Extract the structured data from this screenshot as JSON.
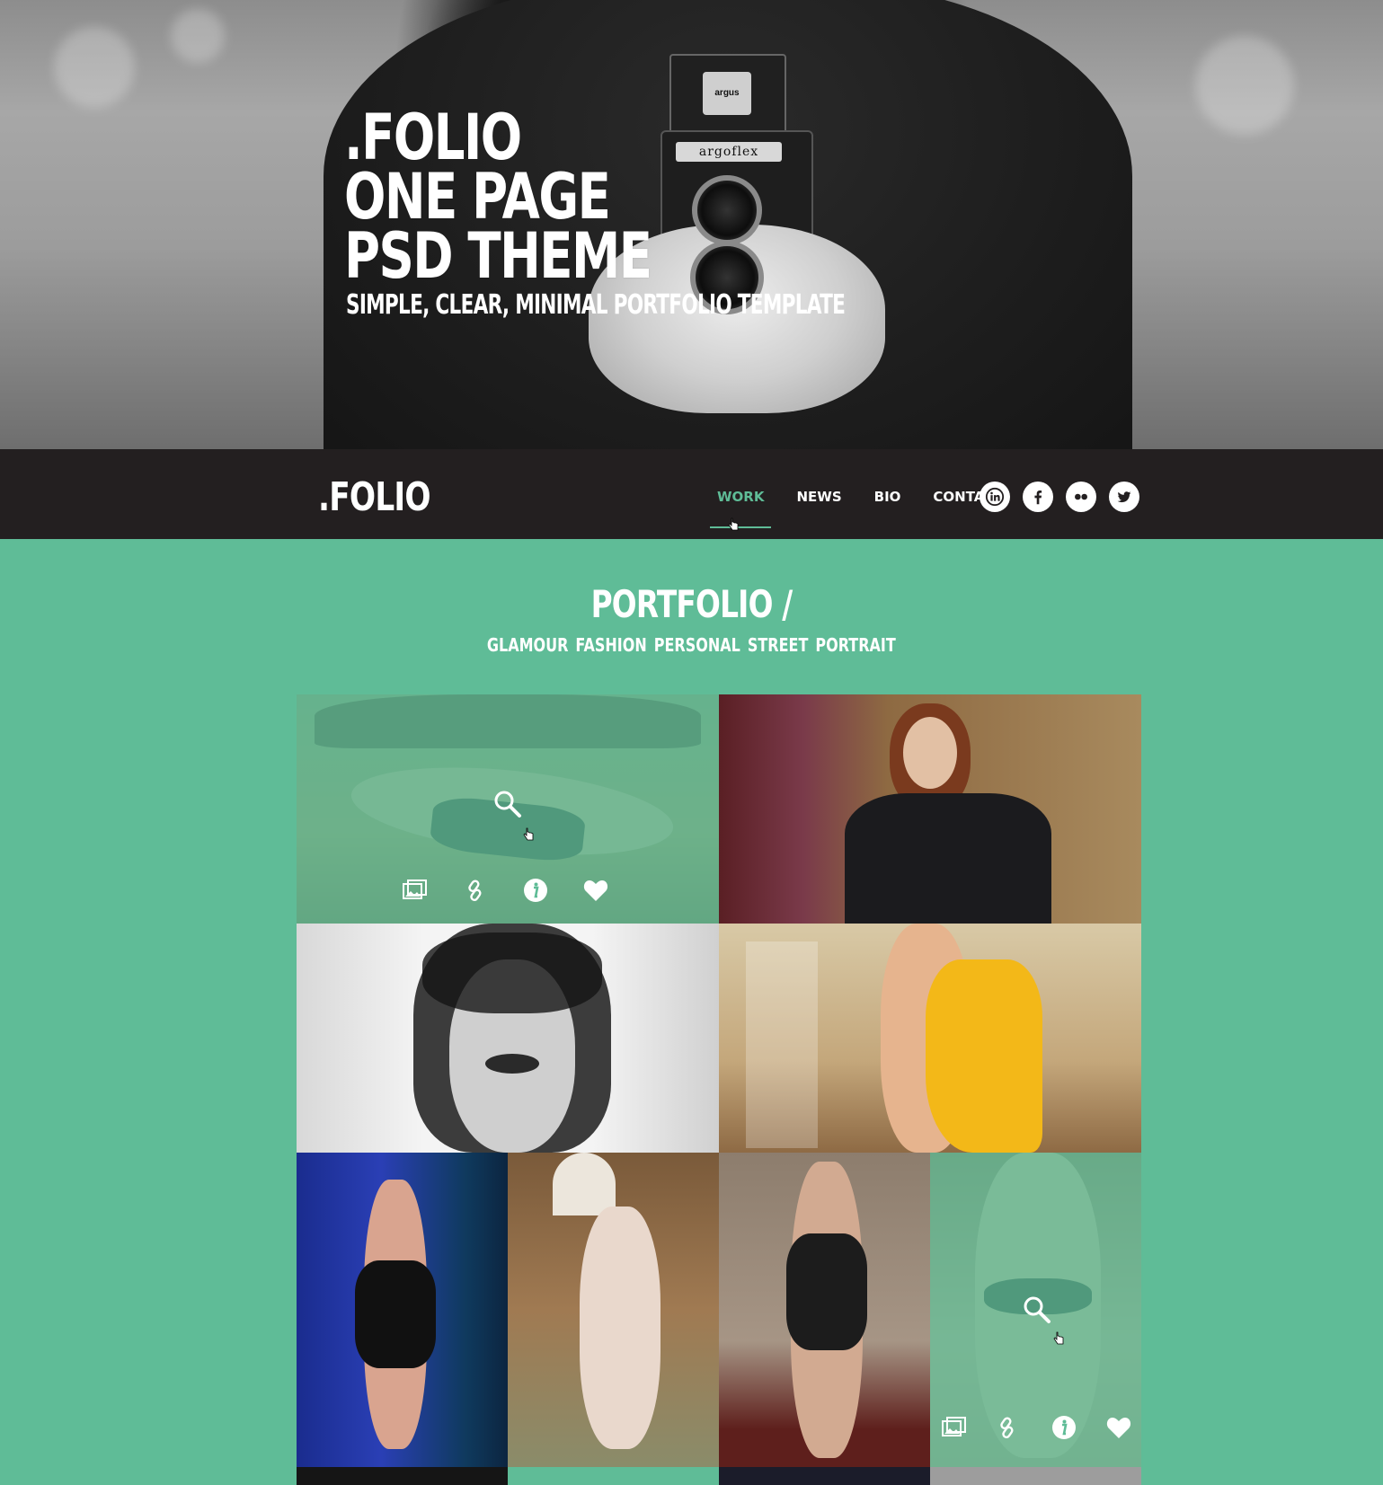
{
  "hero": {
    "title_line1": ".FOLIO",
    "title_line2": "ONE PAGE",
    "title_line3": "PSD THEME",
    "subtitle": "SIMPLE, CLEAR, MINIMAL PORTFOLIO TEMPLATE",
    "camera_badge": "argus",
    "camera_plate": "argoflex"
  },
  "header": {
    "logo": ".FOLIO",
    "nav": [
      "WORK",
      "NEWS",
      "BIO",
      "CONTACT"
    ],
    "active_nav": "WORK",
    "social_icons": [
      "linkedin-icon",
      "facebook-icon",
      "flickr-icon",
      "twitter-icon"
    ]
  },
  "portfolio": {
    "title": "PORTFOLIO /",
    "filters": [
      "GLAMOUR",
      "FASHION",
      "PERSONAL",
      "STREET",
      "PORTRAIT"
    ],
    "overlay_icons": [
      "gallery-icon",
      "link-icon",
      "info-icon",
      "heart-icon"
    ]
  },
  "colors": {
    "accent": "#5fbc97",
    "navbar": "#231f20",
    "text": "#ffffff"
  }
}
